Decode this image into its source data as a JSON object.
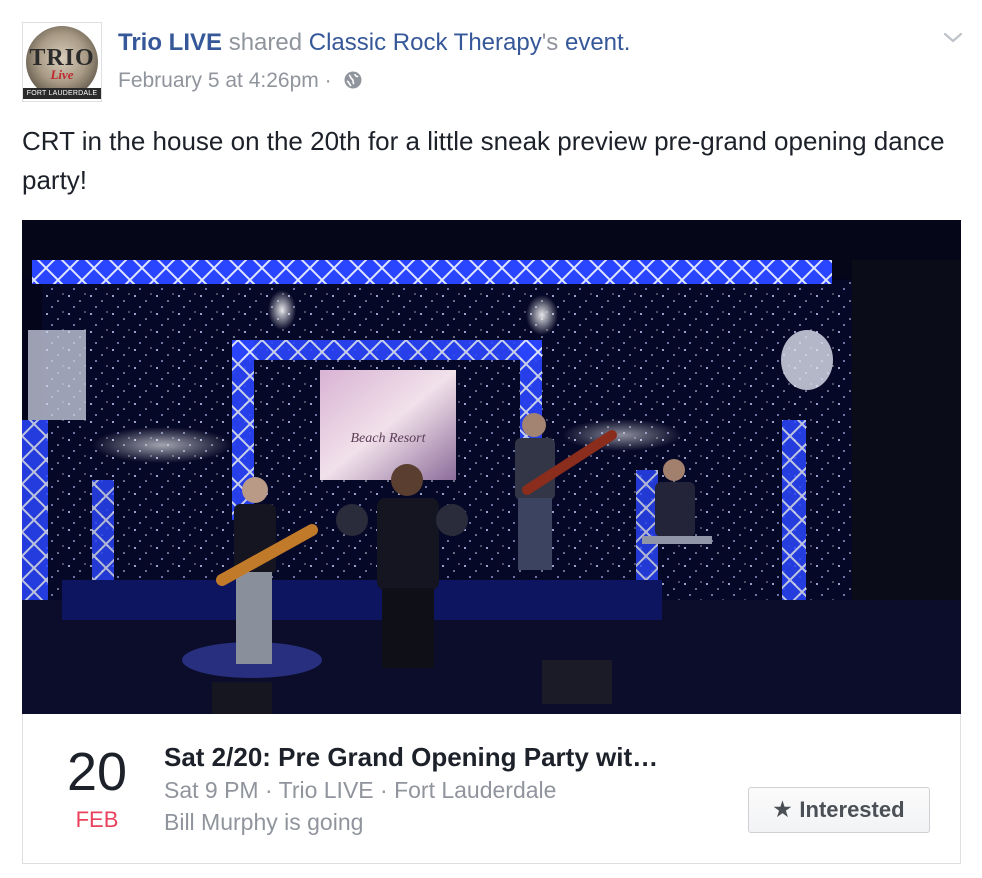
{
  "post": {
    "author": "Trio LIVE",
    "action": "shared",
    "shared_page": "Classic Rock Therapy",
    "shared_suffix": "'s",
    "shared_object": "event.",
    "timestamp": "February 5 at 4:26pm",
    "separator": "·",
    "privacy_icon": "globe-icon",
    "menu_icon": "chevron-down-icon",
    "text": "CRT in the house on the 20th for a little sneak preview pre-grand opening dance party!"
  },
  "avatar": {
    "logo_text": "TRIO",
    "logo_sub": "Live",
    "logo_city": "FORT LAUDERDALE"
  },
  "photo": {
    "screen_text": "Beach Resort",
    "colors": {
      "stage_blue": "#1a3cff",
      "backdrop": "#070a2a"
    }
  },
  "event": {
    "day": "20",
    "month": "FEB",
    "title": "Sat 2/20: Pre Grand Opening Party wit…",
    "details": "Sat 9 PM · Trio LIVE · Fort Lauderdale",
    "going": "Bill Murphy is going",
    "button_icon": "star-icon",
    "button_label": "Interested"
  },
  "colors": {
    "link": "#365899",
    "muted": "#90949c",
    "month_red": "#e9425c",
    "text": "#1d2129"
  }
}
